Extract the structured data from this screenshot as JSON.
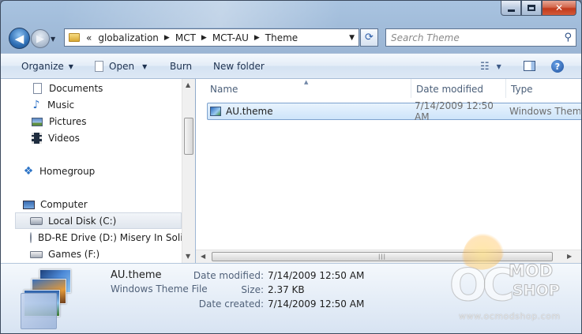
{
  "window": {
    "caption": {
      "minimize_icon": "minimize-icon",
      "maximize_icon": "maximize-icon",
      "close_label": "✕"
    }
  },
  "nav": {
    "back_glyph": "◀",
    "forward_glyph": "▶",
    "history_glyph": "▼"
  },
  "address": {
    "overflow": "«",
    "crumbs": [
      "globalization",
      "MCT",
      "MCT-AU",
      "Theme"
    ],
    "dropdown_glyph": "▼"
  },
  "search": {
    "placeholder": "Search Theme"
  },
  "toolbar": {
    "organize": "Organize",
    "open": "Open",
    "burn": "Burn",
    "new_folder": "New folder",
    "help": "?"
  },
  "navpane": {
    "items": [
      {
        "label": "Documents",
        "icon": "documents-icon"
      },
      {
        "label": "Music",
        "icon": "music-icon"
      },
      {
        "label": "Pictures",
        "icon": "pictures-icon"
      },
      {
        "label": "Videos",
        "icon": "videos-icon"
      },
      {
        "label": "Homegroup",
        "icon": "homegroup-icon"
      },
      {
        "label": "Computer",
        "icon": "computer-icon"
      },
      {
        "label": "Local Disk (C:)",
        "icon": "local-disk-icon"
      },
      {
        "label": "BD-RE Drive (D:) Misery In Solilo",
        "icon": "optical-drive-icon"
      },
      {
        "label": "Games (F:)",
        "icon": "removable-drive-icon"
      }
    ],
    "selected_index": 6
  },
  "filelist": {
    "columns": [
      "Name",
      "Date modified",
      "Type"
    ],
    "rows": [
      {
        "name": "AU.theme",
        "date_modified": "7/14/2009 12:50 AM",
        "type": "Windows Theme File"
      }
    ]
  },
  "details": {
    "name": "AU.theme",
    "type": "Windows Theme File",
    "date_modified_label": "Date modified:",
    "date_modified": "7/14/2009 12:50 AM",
    "size_label": "Size:",
    "size": "2.37 KB",
    "date_created_label": "Date created:",
    "date_created": "7/14/2009 12:50 AM"
  },
  "watermark": {
    "oc": "OC",
    "mod": "MOD",
    "shop": "SHOP",
    "url": "www.ocmodshop.com"
  },
  "colors": {
    "accent": "#2f6fb5",
    "selection": "#cde4fa",
    "close": "#c1391c"
  }
}
